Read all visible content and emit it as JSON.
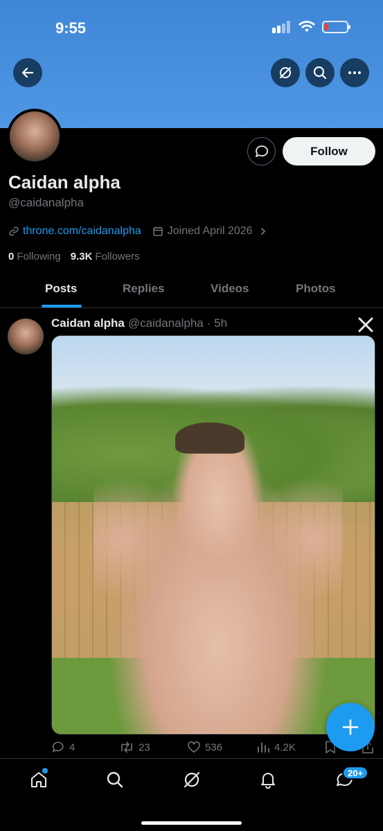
{
  "status_bar": {
    "time": "9:55"
  },
  "header": {
    "back_icon": "arrow-left-icon",
    "grok_icon": "grok-icon",
    "search_icon": "search-icon",
    "more_icon": "more-horizontal-icon"
  },
  "profile": {
    "display_name": "Caidan alpha",
    "handle": "@caidanalpha",
    "link": "throne.com/caidanalpha",
    "joined": "Joined April 2026",
    "following_count": "0",
    "following_label": "Following",
    "followers_count": "9.3K",
    "followers_label": "Followers",
    "follow_label": "Follow"
  },
  "tabs": [
    {
      "label": "Posts",
      "active": true
    },
    {
      "label": "Replies"
    },
    {
      "label": "Videos"
    },
    {
      "label": "Photos"
    }
  ],
  "post": {
    "name": "Caidan alpha",
    "handle": "@caidanalpha",
    "time": "· 5h",
    "replies": "4",
    "reposts": "23",
    "likes": "536",
    "views": "4.2K"
  },
  "bottom_nav": {
    "messages_badge": "20+"
  },
  "colors": {
    "accent": "#1d9bf0",
    "banner": "#4a92e0",
    "background": "#000000"
  }
}
